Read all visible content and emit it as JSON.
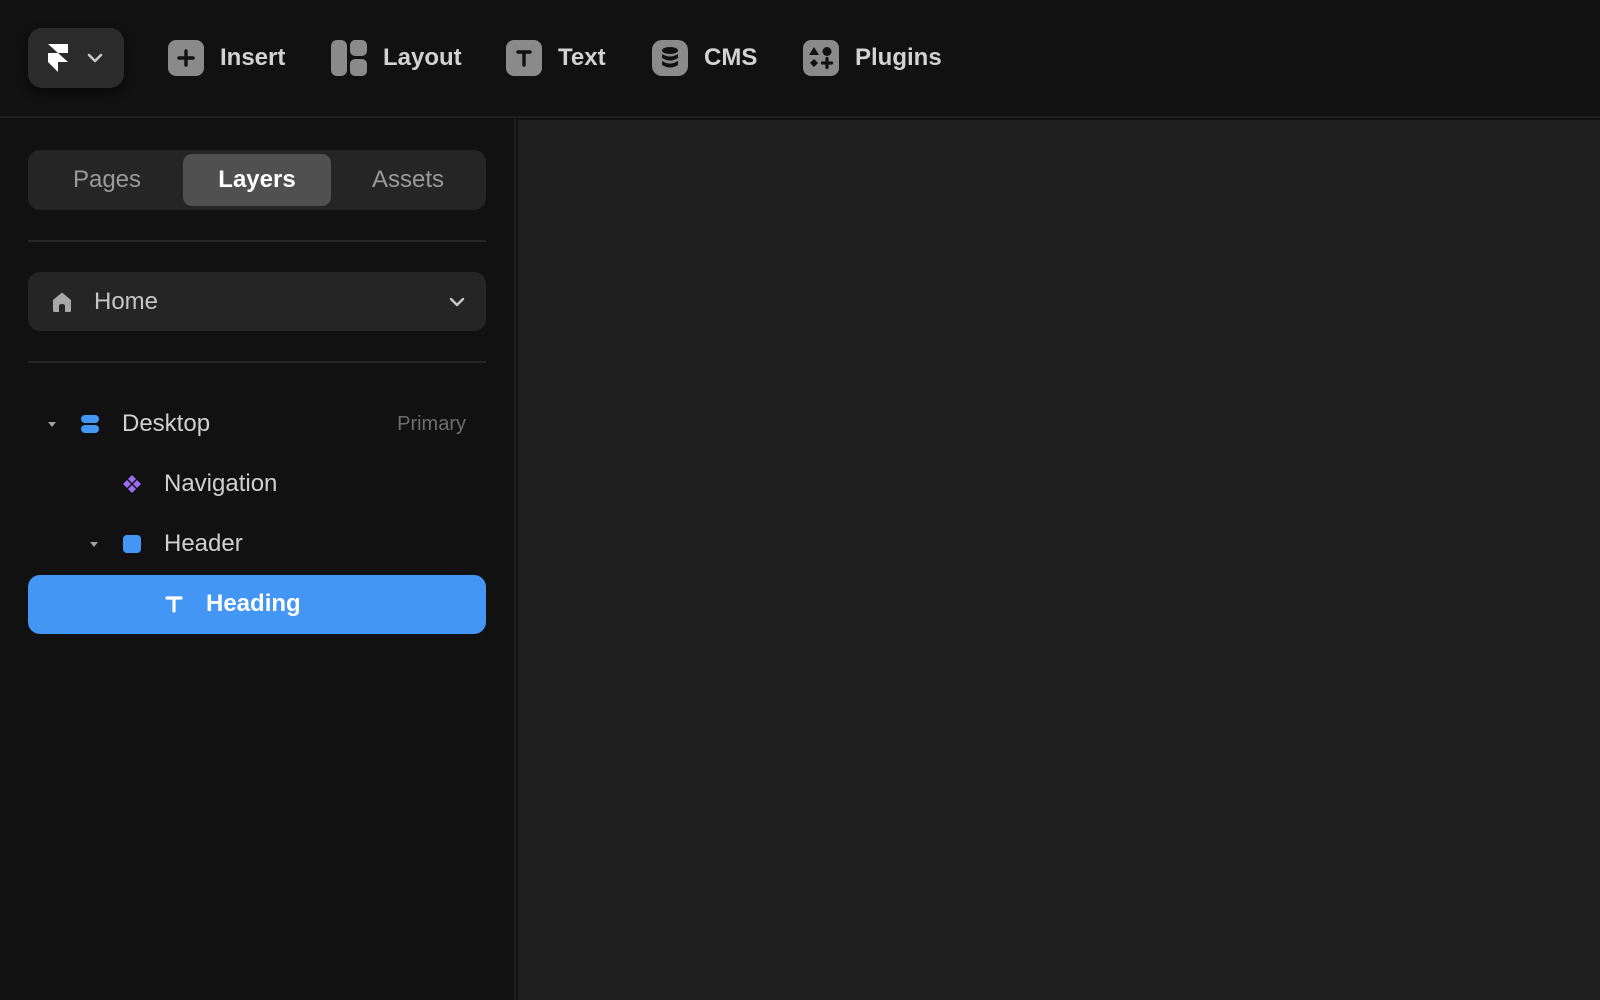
{
  "toolbar": {
    "app_menu_icon": "framer-logo-icon",
    "items": [
      {
        "label": "Insert",
        "icon": "plus-icon"
      },
      {
        "label": "Layout",
        "icon": "layout-icon"
      },
      {
        "label": "Text",
        "icon": "text-icon"
      },
      {
        "label": "CMS",
        "icon": "database-icon"
      },
      {
        "label": "Plugins",
        "icon": "plugins-icon"
      }
    ]
  },
  "sidebar": {
    "tabs": [
      {
        "label": "Pages",
        "active": false
      },
      {
        "label": "Layers",
        "active": true
      },
      {
        "label": "Assets",
        "active": false
      }
    ],
    "page_select": {
      "label": "Home",
      "icon": "home-icon"
    },
    "layers": [
      {
        "name": "Desktop",
        "badge": "Primary",
        "icon": "breakpoint-icon",
        "expanded": true,
        "depth": 0
      },
      {
        "name": "Navigation",
        "icon": "component-icon",
        "depth": 1
      },
      {
        "name": "Header",
        "icon": "frame-icon",
        "expanded": true,
        "depth": 1
      },
      {
        "name": "Heading",
        "icon": "text-layer-icon",
        "selected": true,
        "depth": 2
      }
    ]
  },
  "colors": {
    "accent": "#4496f5",
    "component": "#9b6bf2",
    "background": "#111111",
    "canvas": "#1e1e1e"
  }
}
